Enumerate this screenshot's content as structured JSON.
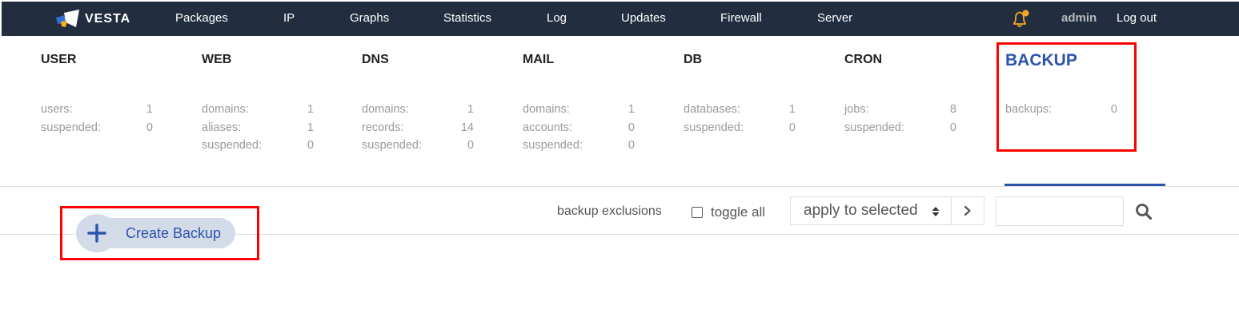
{
  "app": {
    "logo_text": "VESTA"
  },
  "nav": {
    "items": [
      {
        "label": "Packages"
      },
      {
        "label": "IP"
      },
      {
        "label": "Graphs"
      },
      {
        "label": "Statistics"
      },
      {
        "label": "Log"
      },
      {
        "label": "Updates"
      },
      {
        "label": "Firewall"
      },
      {
        "label": "Server"
      }
    ],
    "notifications_icon": "bell-icon",
    "user": "admin",
    "logout": "Log out"
  },
  "sections": [
    {
      "title": "USER",
      "stats": [
        {
          "label": "users:",
          "value": "1"
        },
        {
          "label": "suspended:",
          "value": "0"
        }
      ]
    },
    {
      "title": "WEB",
      "stats": [
        {
          "label": "domains:",
          "value": "1"
        },
        {
          "label": "aliases:",
          "value": "1"
        },
        {
          "label": "suspended:",
          "value": "0"
        }
      ]
    },
    {
      "title": "DNS",
      "stats": [
        {
          "label": "domains:",
          "value": "1"
        },
        {
          "label": "records:",
          "value": "14"
        },
        {
          "label": "suspended:",
          "value": "0"
        }
      ]
    },
    {
      "title": "MAIL",
      "stats": [
        {
          "label": "domains:",
          "value": "1"
        },
        {
          "label": "accounts:",
          "value": "0"
        },
        {
          "label": "suspended:",
          "value": "0"
        }
      ]
    },
    {
      "title": "DB",
      "stats": [
        {
          "label": "databases:",
          "value": "1"
        },
        {
          "label": "suspended:",
          "value": "0"
        }
      ]
    },
    {
      "title": "CRON",
      "stats": [
        {
          "label": "jobs:",
          "value": "8"
        },
        {
          "label": "suspended:",
          "value": "0"
        }
      ]
    },
    {
      "title": "BACKUP",
      "stats": [
        {
          "label": "backups:",
          "value": "0"
        }
      ],
      "active": true
    }
  ],
  "toolbar": {
    "exclusions_link": "backup exclusions",
    "toggle_all": "toggle all",
    "bulk_action": "apply to selected",
    "search_value": ""
  },
  "create_button": {
    "label": "Create Backup"
  },
  "colors": {
    "header_bg": "#222d40",
    "accent": "#2c54ac",
    "create_btn_bg": "#d3dbe9",
    "bell": "#f5a623",
    "highlight": "#ff0000"
  }
}
